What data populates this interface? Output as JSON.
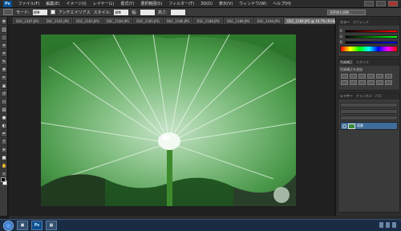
{
  "app": {
    "logo_text": "Ps"
  },
  "menubar": {
    "items": [
      "ファイル(F)",
      "編集(E)",
      "イメージ(I)",
      "レイヤー(L)",
      "書式(Y)",
      "選択範囲(S)",
      "フィルター(T)",
      "3D(D)",
      "表示(V)",
      "ウィンドウ(W)",
      "ヘルプ(H)"
    ]
  },
  "options": {
    "mode_label": "モード:",
    "mode_value": "標準",
    "anti_alias_label": "アンチエイリアス",
    "style_label": "スタイル:",
    "style_value": "標準",
    "width_label": "幅:",
    "height_label": "高さ:",
    "refine_button": "境界線を調整..."
  },
  "tabs": [
    {
      "label": "DSC_2187.JPG",
      "active": false
    },
    {
      "label": "DSC_2181.JPG",
      "active": false
    },
    {
      "label": "DSC_2183.JPG",
      "active": false
    },
    {
      "label": "DSC_2184.JPG",
      "active": false
    },
    {
      "label": "DSC_2185.JPG",
      "active": false
    },
    {
      "label": "DSC_2186.JPG",
      "active": false
    },
    {
      "label": "DSC_2188.JPG",
      "active": false
    },
    {
      "label": "DSC_2189.JPG",
      "active": false
    },
    {
      "label": "DSC_2190.JPG",
      "active": false
    },
    {
      "label": "DSC_2189.JPG @ 16.7% (RGB/8#)",
      "active": true
    }
  ],
  "panels": {
    "color": {
      "tab_color": "カラー",
      "tab_swatches": "スウォッチ",
      "r": "R",
      "g": "G",
      "b": "B"
    },
    "adjustments": {
      "tab_adjust": "色調補正",
      "tab_styles": "スタイル",
      "title": "色調補正を追加"
    },
    "layers": {
      "tab_layers": "レイヤー",
      "tab_channels": "チャンネル",
      "tab_paths": "パス",
      "layer_name": "背景"
    }
  },
  "taskbar": {
    "ps_icon": "Ps"
  },
  "colors": {
    "accent": "#0b4f8f",
    "leaf": "#3d8a3d",
    "taskbar": "#1a2c44"
  }
}
